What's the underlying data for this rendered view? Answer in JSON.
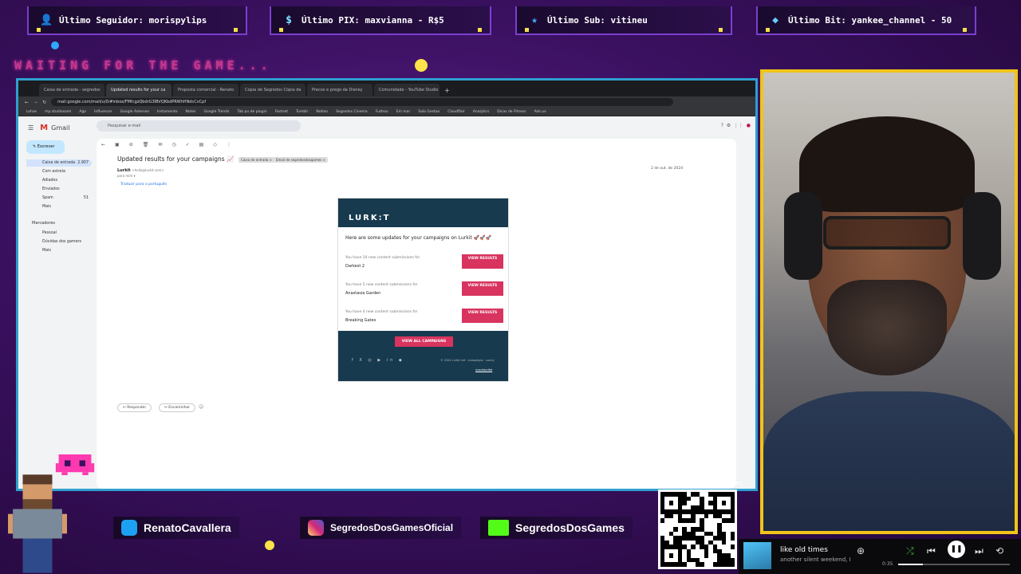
{
  "alerts": [
    {
      "icon": "user-icon",
      "text": "Último Seguidor: morispylips"
    },
    {
      "icon": "dollar-icon",
      "text": "Último PIX: maxvianna - R$5"
    },
    {
      "icon": "star-icon",
      "text": "Último Sub: vitineu"
    },
    {
      "icon": "gem-icon",
      "text": "Último Bit: yankee_channel - 50"
    }
  ],
  "waiting_text": "WAITING FOR THE GAME...",
  "browser": {
    "tabs": [
      "Caixa de entrada - segredos",
      "Updated results for your ca",
      "Proposta comercial - Renato",
      "Copia de Segredos Cópia da",
      "Precos e prego da Disney",
      "Comunidade - YouTube Studio"
    ],
    "url": "mail.google.com/mail/u/0/#inbox/FMfcgzQbdrG3lBVQKbdPRWhHNdcCvCpf",
    "bookmarks": [
      "Lohas",
      "mp.studiosomi",
      "Ago",
      "Influencer",
      "Google Adsense",
      "Instamento",
      "Notes",
      "Google Trends",
      "Tab pu de plugin",
      "Fastnet",
      "Tumblr",
      "Notion",
      "Segredos Cinema",
      "Fuzhou",
      "Em mar",
      "Sala Gestao",
      "Cloudflair",
      "Analytics",
      "Dicas de Fitness",
      "Ads.ux"
    ]
  },
  "gmail": {
    "app_name": "Gmail",
    "search_placeholder": "Pesquisar e-mail",
    "compose_label": "Escrever",
    "nav": [
      {
        "label": "Caixa de entrada",
        "count": "2.907"
      },
      {
        "label": "Com estrela",
        "count": ""
      },
      {
        "label": "Adiados",
        "count": ""
      },
      {
        "label": "Enviados",
        "count": ""
      },
      {
        "label": "Spam",
        "count": "51"
      },
      {
        "label": "Mais",
        "count": ""
      }
    ],
    "labels_title": "Marcadores",
    "labels": [
      "Pessoal",
      "Dúvidas dos gamers",
      "Mais"
    ],
    "subject": "Updated results for your campaigns 📈",
    "chips": [
      "Caixa de entrada ×",
      "Email de segredosdosgames ×"
    ],
    "sender": "Lurkit",
    "sender_addr": "<hello@lurkit.com>",
    "to_line": "para mim ▾",
    "translate_text": "Traduzir para o português",
    "date_text": "2 de out. de 2024",
    "email": {
      "logo": "LURK:T",
      "intro": "Here are some updates for your campaigns on Lurkit 🚀🚀🚀",
      "rows": [
        {
          "line": "You have 10 new content submissions for",
          "game": "Darkest 2",
          "button": "VIEW RESULTS"
        },
        {
          "line": "You have 5 new content submissions for",
          "game": "Anastasia Garden",
          "button": "VIEW RESULTS"
        },
        {
          "line": "You have 4 new content submissions for",
          "game": "Breaking Gates",
          "button": "VIEW RESULTS"
        }
      ],
      "footer_button": "VIEW ALL CAMPAIGNS",
      "footer_social": "f  X  ◎  ▶  in  ◆",
      "footer_address": "© 2024 Lurkit Ltd · campaigns · sunny",
      "footer_link": "unsubscribe"
    },
    "reply_label": "Responder",
    "forward_label": "Encaminhar"
  },
  "socials": [
    {
      "icon": "twitter-icon",
      "name": "RenatoCavallera",
      "color": "#1da1f2"
    },
    {
      "icon": "instagram-icon",
      "name": "SegredosDosGamesOficial",
      "color": "#d62976"
    },
    {
      "icon": "kick-icon",
      "name": "SegredosDosGames",
      "color": "#53fc18"
    }
  ],
  "qr_label": "livepix.gg/segredosdosgames",
  "player": {
    "song": "like old times",
    "artist": "another silent weekend, I",
    "time": "0:35",
    "progress": 0.22
  },
  "colors": {
    "accent_border": "#2f9fd0",
    "webcam_border": "#f0c419",
    "lurkit_navy": "#173a4f",
    "lurkit_pink": "#d8345f"
  }
}
